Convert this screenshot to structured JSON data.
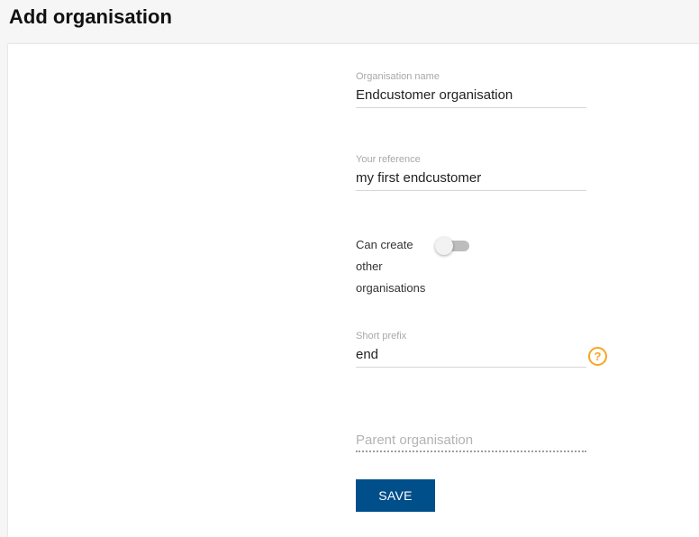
{
  "page": {
    "title": "Add organisation"
  },
  "form": {
    "organisation_name": {
      "label": "Organisation name",
      "value": "Endcustomer organisation"
    },
    "your_reference": {
      "label": "Your reference",
      "value": "my first endcustomer"
    },
    "can_create": {
      "label": "Can create other organisations",
      "checked": false
    },
    "short_prefix": {
      "label": "Short prefix",
      "value": "end",
      "help_icon": "question-circle-icon",
      "help_symbol": "?"
    },
    "parent_organisation": {
      "placeholder": "Parent organisation"
    },
    "save_label": "SAVE"
  },
  "colors": {
    "primary": "#004f8b",
    "help_accent": "#f5a623",
    "toggle_off_track": "#bdbdbd"
  }
}
